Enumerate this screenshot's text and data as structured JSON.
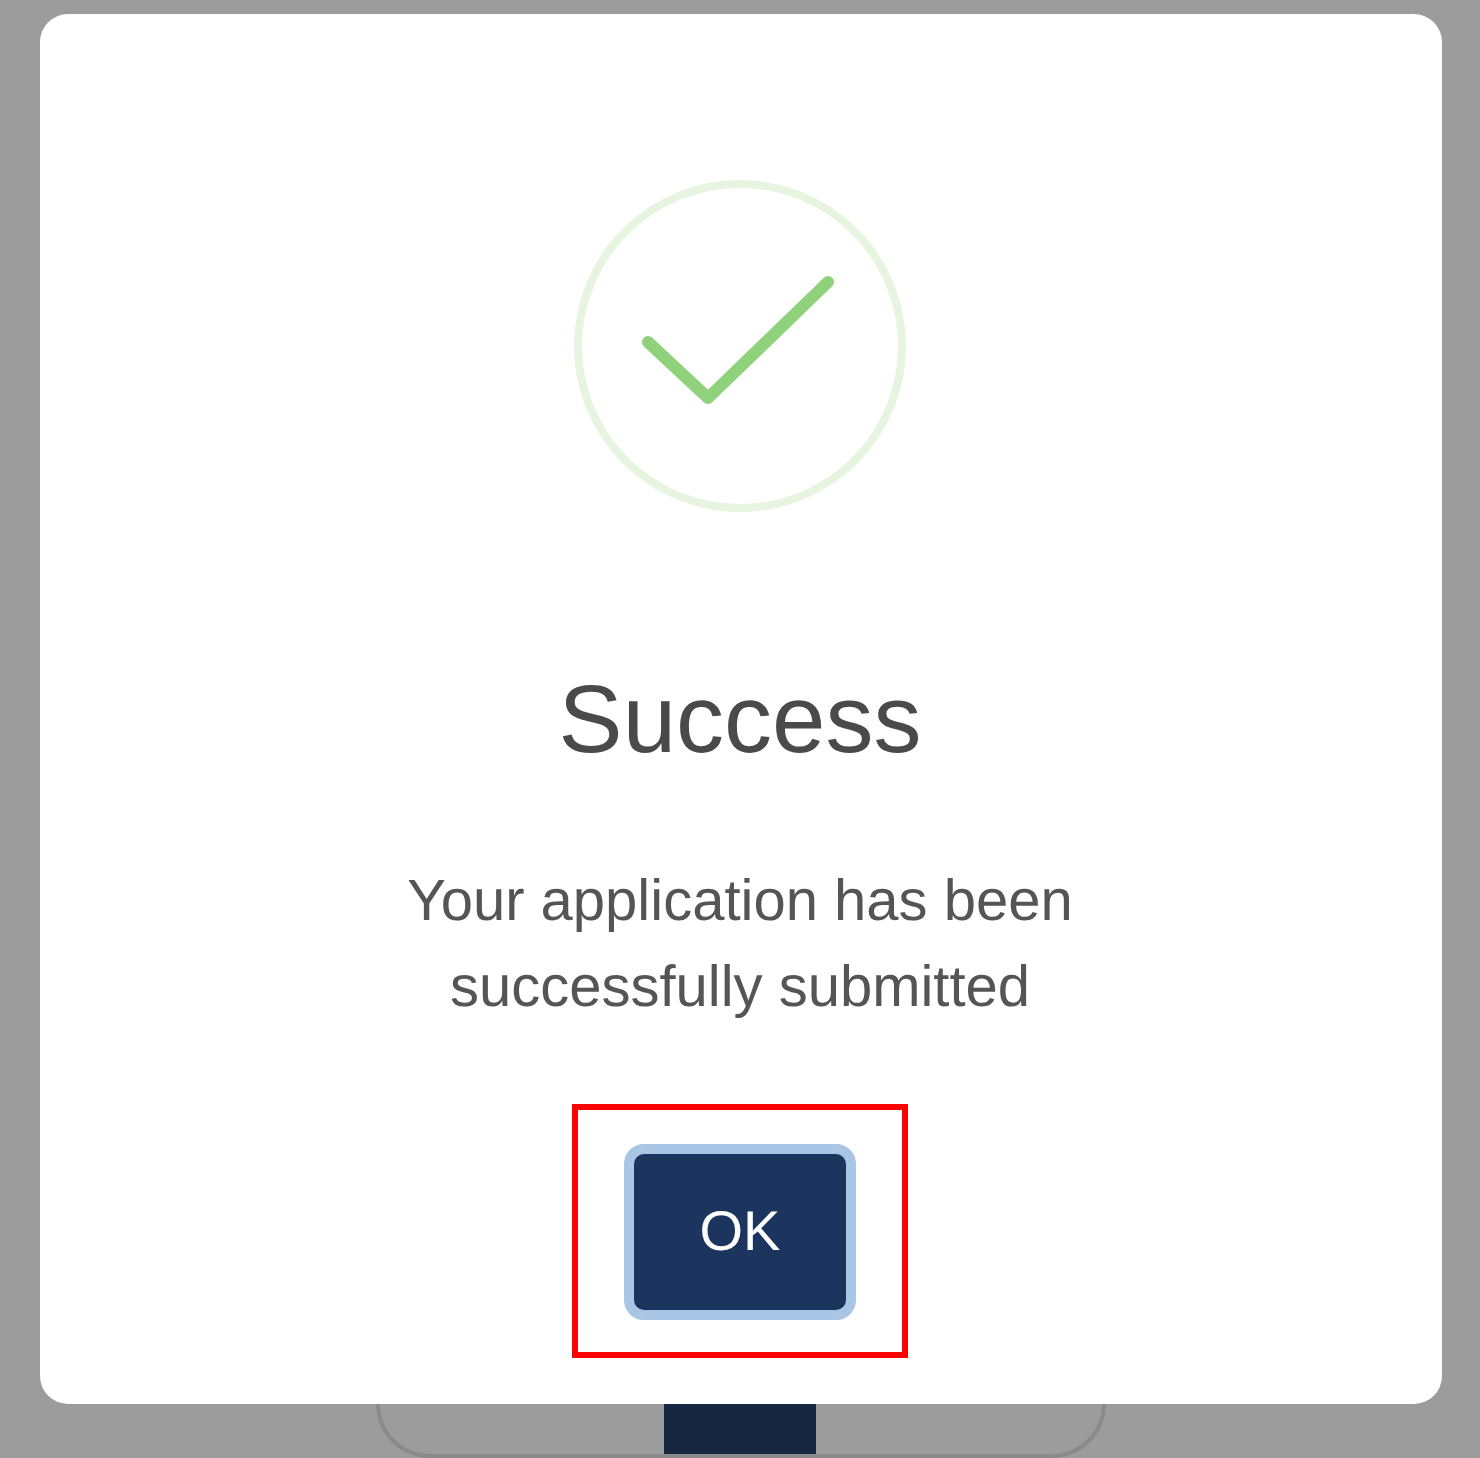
{
  "dialog": {
    "title": "Success",
    "message": "Your application has been successfully submitted",
    "button": "OK",
    "button_highlighted": true
  }
}
